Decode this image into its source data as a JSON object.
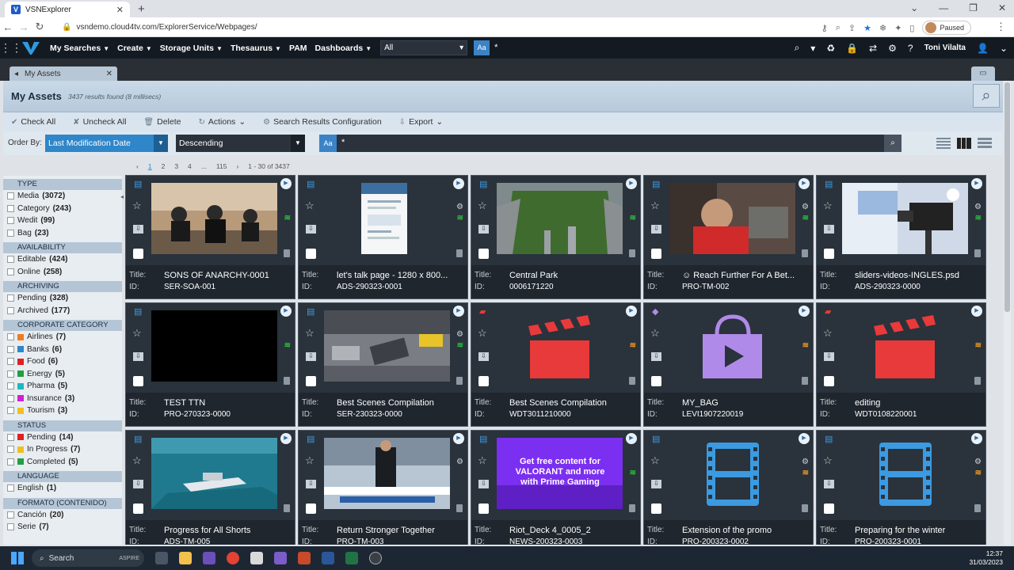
{
  "browser": {
    "tab_title": "VSNExplorer",
    "url": "vsndemo.cloud4tv.com/ExplorerService/Webpages/",
    "profile_status": "Paused"
  },
  "app": {
    "menu": [
      "My Searches",
      "Create",
      "Storage Units",
      "Thesaurus",
      "PAM",
      "Dashboards"
    ],
    "menu_has_caret": [
      true,
      true,
      true,
      true,
      false,
      true
    ],
    "scope": "All",
    "case_toggle": "Aa",
    "query": "*",
    "user": "Toni Vilalta"
  },
  "pane": {
    "tab_label": "My Assets",
    "title": "My Assets",
    "results_info": "3437 results found (8 millisecs)"
  },
  "toolbar": {
    "check_all": "Check All",
    "uncheck_all": "Uncheck All",
    "delete": "Delete",
    "actions": "Actions",
    "search_results_config": "Search Results Configuration",
    "export": "Export"
  },
  "order": {
    "label": "Order By:",
    "field": "Last Modification Date",
    "direction": "Descending",
    "filter_case": "Aa",
    "filter_value": "*"
  },
  "pager": {
    "prev": "‹",
    "pages": [
      "1",
      "2",
      "3",
      "4",
      "...",
      "115"
    ],
    "next": "›",
    "range": "1 - 30 of 3437"
  },
  "facets": [
    {
      "header": "TYPE",
      "items": [
        {
          "label": "Media",
          "count": "(3072)"
        },
        {
          "label": "Category",
          "count": "(243)"
        },
        {
          "label": "Wedit",
          "count": "(99)"
        },
        {
          "label": "Bag",
          "count": "(23)"
        }
      ]
    },
    {
      "header": "AVAILABILITY",
      "items": [
        {
          "label": "Editable",
          "count": "(424)"
        },
        {
          "label": "Online",
          "count": "(258)"
        }
      ]
    },
    {
      "header": "ARCHIVING",
      "items": [
        {
          "label": "Pending",
          "count": "(328)"
        },
        {
          "label": "Archived",
          "count": "(177)"
        }
      ]
    },
    {
      "header": "CORPORATE CATEGORY",
      "items": [
        {
          "label": "Airlines",
          "count": "(7)",
          "color": "#f07b1e"
        },
        {
          "label": "Banks",
          "count": "(6)",
          "color": "#2f86c8"
        },
        {
          "label": "Food",
          "count": "(6)",
          "color": "#e02020"
        },
        {
          "label": "Energy",
          "count": "(5)",
          "color": "#20a040"
        },
        {
          "label": "Pharma",
          "count": "(5)",
          "color": "#20b8c0"
        },
        {
          "label": "Insurance",
          "count": "(3)",
          "color": "#d020d0"
        },
        {
          "label": "Tourism",
          "count": "(3)",
          "color": "#f0c020"
        }
      ]
    },
    {
      "header": "STATUS",
      "items": [
        {
          "label": "Pending",
          "count": "(14)",
          "color": "#e02020"
        },
        {
          "label": "In Progress",
          "count": "(7)",
          "color": "#f0c020"
        },
        {
          "label": "Completed",
          "count": "(5)",
          "color": "#20a040"
        }
      ]
    },
    {
      "header": "LANGUAGE",
      "items": [
        {
          "label": "English",
          "count": "(1)"
        }
      ]
    },
    {
      "header": "FORMATO (CONTENIDO)",
      "items": [
        {
          "label": "Canción",
          "count": "(20)"
        },
        {
          "label": "Serie",
          "count": "(7)"
        }
      ]
    }
  ],
  "assets": [
    {
      "title": "SONS OF ANARCHY-0001",
      "id": "SER-SOA-001",
      "thumb": "bikers",
      "icon": "film-icon",
      "status": "green",
      "has_gear": false
    },
    {
      "title": "let's talk page - 1280 x 800...",
      "id": "ADS-290323-0001",
      "thumb": "webpage",
      "icon": "film-icon",
      "status": "green",
      "has_gear": true
    },
    {
      "title": "Central Park",
      "id": "0006171220",
      "thumb": "park",
      "icon": "film-icon",
      "status": "green",
      "has_gear": false
    },
    {
      "title": "☺ Reach Further For A Bet...",
      "id": "PRO-TM-002",
      "thumb": "kid",
      "icon": "film-icon",
      "status": "green",
      "has_gear": true
    },
    {
      "title": "sliders-videos-INGLES.psd",
      "id": "ADS-290323-0000",
      "thumb": "camera",
      "icon": "film-icon",
      "status": "green",
      "has_gear": true
    },
    {
      "title": "TEST TTN",
      "id": "PRO-270323-0000",
      "thumb": "black",
      "icon": "film-icon",
      "status": "green",
      "has_gear": false
    },
    {
      "title": "Best Scenes Compilation",
      "id": "SER-230323-0000",
      "thumb": "crash",
      "icon": "film-icon",
      "status": "green",
      "has_gear": true
    },
    {
      "title": "Best Scenes Compilation",
      "id": "WDT3011210000",
      "thumb": "clapper",
      "icon": "clapper-icon",
      "status": "orange",
      "has_gear": false
    },
    {
      "title": "MY_BAG",
      "id": "LEVI1907220019",
      "thumb": "bag",
      "icon": "bag-icon",
      "status": "orange",
      "has_gear": false
    },
    {
      "title": "editing",
      "id": "WDT0108220001",
      "thumb": "clapper",
      "icon": "clapper-icon",
      "status": "orange",
      "has_gear": false
    },
    {
      "title": "Progress for All Shorts",
      "id": "ADS-TM-005",
      "thumb": "boat",
      "icon": "film-icon",
      "status": "none",
      "has_gear": false
    },
    {
      "title": "Return Stronger Together",
      "id": "PRO-TM-003",
      "thumb": "news",
      "icon": "film-icon",
      "status": "none",
      "has_gear": true
    },
    {
      "title": "Riot_Deck 4_0005_2",
      "id": "NEWS-200323-0003",
      "thumb": "promo",
      "icon": "film-icon",
      "status": "green",
      "has_gear": false
    },
    {
      "title": "Extension of the promo",
      "id": "PRO-200323-0002",
      "thumb": "filmstrip",
      "icon": "film-icon",
      "status": "orange",
      "has_gear": true
    },
    {
      "title": "Preparing for the winter",
      "id": "PRO-200323-0001",
      "thumb": "filmstrip",
      "icon": "film-icon",
      "status": "orange",
      "has_gear": true
    }
  ],
  "labels": {
    "title": "Title:",
    "id": "ID:"
  },
  "promo_text": "Get free content for VALORANT and more with Prime Gaming",
  "taskbar": {
    "search": "Search",
    "brand": "ASPIRE",
    "time": "12:37",
    "date": "31/03/2023"
  }
}
